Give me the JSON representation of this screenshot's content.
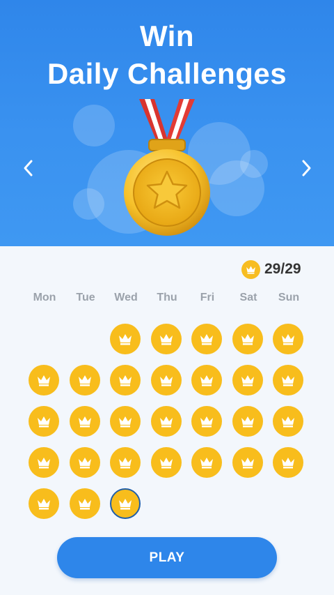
{
  "header": {
    "title_line1": "Win",
    "title_line2": "Daily Challenges"
  },
  "navigation": {
    "prev_icon": "chevron-left-icon",
    "next_icon": "chevron-right-icon"
  },
  "medal": {
    "icon": "gold-medal-star-icon"
  },
  "progress": {
    "icon": "crown-coin-icon",
    "text": "29/29"
  },
  "calendar": {
    "weekdays": [
      "Mon",
      "Tue",
      "Wed",
      "Thu",
      "Fri",
      "Sat",
      "Sun"
    ],
    "completed_days": 29,
    "today_index": 28
  },
  "play_button": {
    "label": "PLAY"
  },
  "colors": {
    "hero_blue": "#2f86ea",
    "coin_gold": "#f8bd1c",
    "today_ring": "#1f5ea8",
    "play_button": "#2e86ea"
  }
}
